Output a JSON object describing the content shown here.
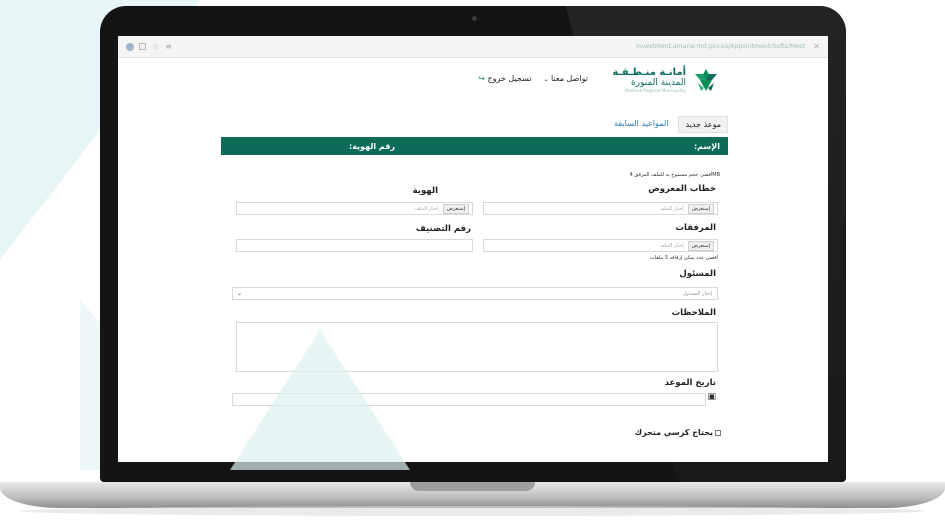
{
  "browser": {
    "url": "investment.amana-md.gov.sa/Appointment/Softs/Meet",
    "close_glyph": "✕",
    "star_glyph": "☆"
  },
  "header": {
    "logo_line1": "أمانـة منـطـقـة",
    "logo_line2": "المدينة المنورة",
    "logo_line3": "Madinah Regional Municipality",
    "contact_label": "تواصل معنا",
    "logout_label": "تسجيل خروج",
    "logout_icon": "↪"
  },
  "tabs": {
    "new_appointment": "موعد جديد",
    "previous_appointments": "المواعيد السابقة"
  },
  "info_bar": {
    "name_label": "الإسم:",
    "id_label": "رقم الهوية:"
  },
  "form": {
    "max_size_hint": "أقصى حجم مسموح به للملف المرفق 4MB",
    "letter_label": "خطاب المعروض",
    "id_label": "الهوية",
    "browse_label": "إستعرض",
    "file_placeholder": "إختار الملف",
    "attachments_label": "المرفقات",
    "classification_label": "رقم التصنيف",
    "max_files_hint": "أقصى عدد يمكن إرفاقه 3 ملفات",
    "official_label": "المسئول",
    "official_placeholder": "إختار المسئول",
    "notes_label": "الملاحظات",
    "date_label": "تاريخ الموعد",
    "wheelchair_label": "يحتاج كرسي متحرك"
  },
  "colors": {
    "brand_green": "#0c6c59",
    "link_blue": "#2a7ab8"
  }
}
